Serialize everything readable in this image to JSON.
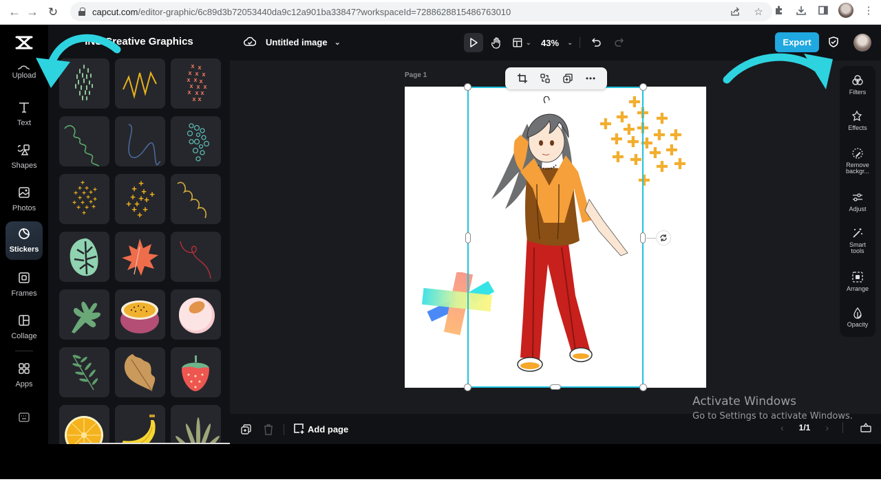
{
  "browser": {
    "url_host": "capcut.com",
    "url_path": "/editor-graphic/6c89d3b72053440da9c12a901ba33847?workspaceId=7288628815486763010",
    "icons": [
      "back-icon",
      "forward-icon",
      "reload-icon",
      "lock-icon",
      "share-icon",
      "bookmark-star-icon",
      "extensions-icon",
      "download-icon",
      "sidepanel-icon",
      "profile-avatar"
    ]
  },
  "app": {
    "brand": "CapCut",
    "rail": [
      {
        "id": "upload",
        "label": "Upload",
        "icon": "upload-icon"
      },
      {
        "id": "text",
        "label": "Text",
        "icon": "text-icon"
      },
      {
        "id": "shapes",
        "label": "Shapes",
        "icon": "shapes-icon"
      },
      {
        "id": "photos",
        "label": "Photos",
        "icon": "photos-icon"
      },
      {
        "id": "stickers",
        "label": "Stickers",
        "icon": "sticker-icon",
        "active": true
      },
      {
        "id": "frames",
        "label": "Frames",
        "icon": "frame-icon"
      },
      {
        "id": "collage",
        "label": "Collage",
        "icon": "collage-icon"
      },
      {
        "id": "apps",
        "label": "Apps",
        "icon": "apps-grid-icon"
      }
    ],
    "keyboard_shortcuts_icon": "keyboard-icon",
    "panel": {
      "title": "INS Creative Graphics",
      "stickers": [
        "green-dashes",
        "yellow-zigzag",
        "coral-crosses",
        "green-curly-line",
        "blue-squiggle",
        "teal-circles",
        "gold-sparkles",
        "gold-crosses",
        "gold-wave",
        "monstera-leaf",
        "orange-maple-leaf",
        "red-squiggle",
        "green-oak-leaf",
        "passion-fruit",
        "peach-half",
        "fern-sprig",
        "brown-oak-leaf",
        "strawberry",
        "lemon-slice",
        "banana",
        "sage-fronds"
      ]
    },
    "topbar": {
      "doc_title": "Untitled image",
      "zoom": "43%",
      "export_label": "Export"
    },
    "canvas": {
      "page_label": "Page 1",
      "floating_toolbar": [
        "crop-icon",
        "replace-icon",
        "duplicate-icon",
        "more-icon"
      ]
    },
    "right_tools": [
      {
        "label": "Filters",
        "icon": "filters-icon"
      },
      {
        "label": "Effects",
        "icon": "effects-icon"
      },
      {
        "label": "Remove backgr...",
        "icon": "remove-background-icon"
      },
      {
        "label": "Adjust",
        "icon": "adjust-icon"
      },
      {
        "label": "Smart tools",
        "icon": "magic-wand-icon"
      },
      {
        "label": "Arrange",
        "icon": "arrange-icon"
      },
      {
        "label": "Opacity",
        "icon": "opacity-icon"
      }
    ],
    "bottombar": {
      "add_page_label": "Add page",
      "pager": "1/1"
    }
  },
  "watermark": {
    "line1": "Activate Windows",
    "line2": "Go to Settings to activate Windows."
  },
  "colors": {
    "accent": "#20a8e0",
    "selection": "#1fc3de",
    "annotation_arrow": "#2ed3e0"
  }
}
